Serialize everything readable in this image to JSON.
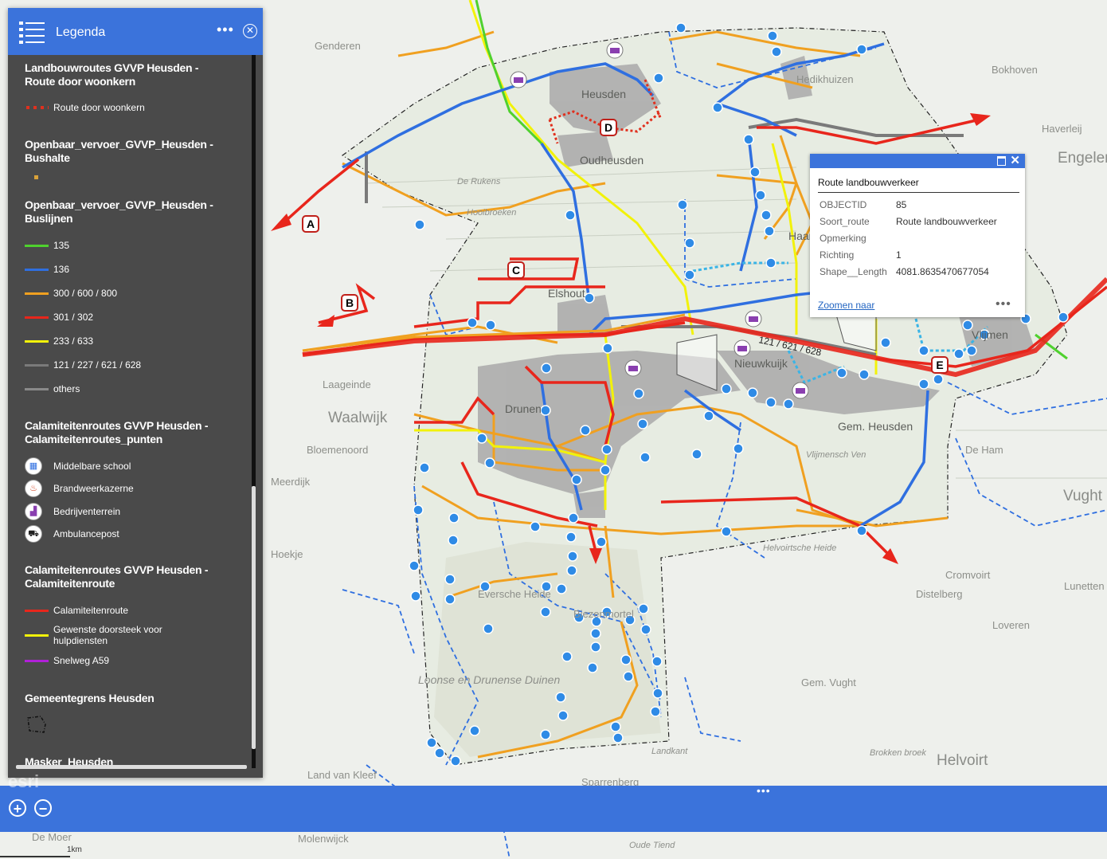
{
  "legend": {
    "title": "Legenda",
    "groups": [
      {
        "title": "Landbouwroutes GVVP Heusden - Route door woonkern",
        "items": [
          {
            "label": "Route door woonkern",
            "color": "#e0301e",
            "style": "dotted-line"
          }
        ]
      },
      {
        "title": "Openbaar_vervoer_GVVP_Heusden - Bushalte",
        "items": [
          {
            "label": "",
            "color": "#d9a23a",
            "style": "square"
          }
        ]
      },
      {
        "title": "Openbaar_vervoer_GVVP_Heusden - Buslijnen",
        "items": [
          {
            "label": "135",
            "color": "#4fd12e"
          },
          {
            "label": "136",
            "color": "#2f6fe0"
          },
          {
            "label": "300 / 600 / 800",
            "color": "#f0a020"
          },
          {
            "label": "301 / 302",
            "color": "#e8261c"
          },
          {
            "label": "233 / 633",
            "color": "#f2f20a"
          },
          {
            "label": "121 / 227 / 621 / 628",
            "color": "#7a7a7a"
          },
          {
            "label": "others",
            "color": "#8a8a8a"
          }
        ]
      },
      {
        "title": "Calamiteitenroutes GVVP Heusden - Calamiteitenroutes_punten",
        "items": [
          {
            "label": "Middelbare school",
            "icon": "school-icon",
            "color": "#2f6fe0"
          },
          {
            "label": "Brandweerkazerne",
            "icon": "fire-station-icon",
            "color": "#d2401e"
          },
          {
            "label": "Bedrijventerrein",
            "icon": "industry-icon",
            "color": "#8a3fb0"
          },
          {
            "label": "Ambulancepost",
            "icon": "ambulance-icon",
            "color": "#222222"
          }
        ]
      },
      {
        "title": "Calamiteitenroutes GVVP Heusden - Calamiteitenroute",
        "items": [
          {
            "label": "Calamiteitenroute",
            "color": "#e8261c"
          },
          {
            "label": "Gewenste doorsteek voor hulpdiensten",
            "color": "#f2f20a"
          },
          {
            "label": "Snelweg A59",
            "color": "#b020d8"
          }
        ]
      },
      {
        "title": "Gemeentegrens Heusden",
        "items": [
          {
            "label": "",
            "style": "dashed-box"
          }
        ]
      },
      {
        "title": "Masker_Heusden",
        "items": []
      }
    ]
  },
  "popup": {
    "title": "Route landbouwverkeer",
    "fields": [
      {
        "key": "OBJECTID",
        "value": "85"
      },
      {
        "key": "Soort_route",
        "value": "Route landbouwverkeer"
      },
      {
        "key": "Opmerking",
        "value": ""
      },
      {
        "key": "Richting",
        "value": "1"
      },
      {
        "key": "Shape__Length",
        "value": "4081.8635470677054"
      }
    ],
    "zoom_link": "Zoomen naar"
  },
  "map": {
    "route_letters": [
      "A",
      "B",
      "C",
      "D",
      "E"
    ],
    "road_label": "121 / 621 / 628",
    "place_labels": [
      "Waalwijk",
      "Genderen",
      "Heusden",
      "Oudheusden",
      "Haarsteeg",
      "Nieuwkuijk",
      "Vlijmen",
      "Gem. Heusden",
      "Drunen",
      "Elshout",
      "Hedikhuizen",
      "Laageinde",
      "Bloemenoord",
      "Meerdijk",
      "Land van Kleef",
      "Helvoirt",
      "Vught",
      "Gem. Vught",
      "Cromvoirt",
      "Distelberg",
      "Loveren",
      "Engelen",
      "Haverleij",
      "Bokhoven",
      "De Ham",
      "Loonse en Drunense Duinen",
      "Helvoirtsche Heide",
      "Vlijmensch Ven",
      "Hooibroeken",
      "De Rukens",
      "Eversche Heide",
      "Biezenmortel",
      "Sparrenberg",
      "Molenwijck",
      "De Moer",
      "Hoekje",
      "Brokken broek",
      "Landkant",
      "Oude Tiend",
      "Lunetten"
    ],
    "attribution": "esri"
  },
  "scale": {
    "label": "1km"
  },
  "controls": {
    "zoom_in": "+",
    "zoom_out": "−"
  }
}
